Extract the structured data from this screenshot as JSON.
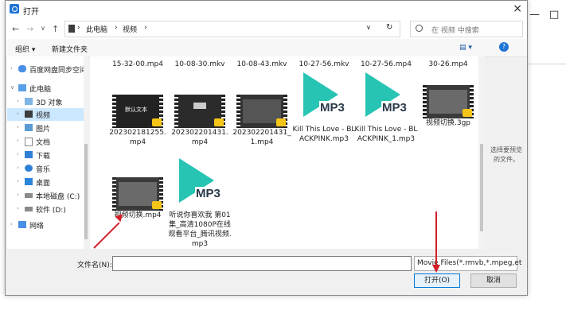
{
  "window": {
    "title": "打开",
    "close": "×"
  },
  "background_window": {
    "minimize": "—",
    "maximize": "□"
  },
  "nav_buttons": {
    "back": "←",
    "forward": "→",
    "dropdown": "∨",
    "up": "↑"
  },
  "address": {
    "segments": [
      "此电脑",
      "视频"
    ],
    "separator": "›",
    "expand": "∨",
    "refresh": "↻"
  },
  "search": {
    "placeholder": "在 视频 中搜索"
  },
  "commands": {
    "organize": "组织 ▾",
    "new_folder": "新建文件夹",
    "view": "▤ ▾",
    "help": "?"
  },
  "sidebar": {
    "items": [
      {
        "label": "百度网盘同步空间",
        "expand": "›",
        "icon": "cloud"
      },
      {
        "label": "此电脑",
        "expand": "∨",
        "icon": "pc"
      },
      {
        "label": "3D 对象",
        "expand": "›",
        "icon": "cube"
      },
      {
        "label": "视频",
        "expand": "›",
        "icon": "video",
        "selected": true
      },
      {
        "label": "图片",
        "expand": "›",
        "icon": "picture"
      },
      {
        "label": "文档",
        "expand": "›",
        "icon": "doc"
      },
      {
        "label": "下载",
        "expand": "›",
        "icon": "download"
      },
      {
        "label": "音乐",
        "expand": "›",
        "icon": "music"
      },
      {
        "label": "桌面",
        "expand": "›",
        "icon": "desktop"
      },
      {
        "label": "本地磁盘 (C:)",
        "expand": "›",
        "icon": "drive"
      },
      {
        "label": "软件 (D:)",
        "expand": "›",
        "icon": "drive"
      },
      {
        "label": "网络",
        "expand": "›",
        "icon": "network"
      }
    ]
  },
  "top_row": [
    "15-32-00.mp4",
    "10-08-30.mkv",
    "10-08-43.mkv",
    "10-27-56.mkv",
    "10-27-56.mp4",
    "30-26.mp4"
  ],
  "files_row1": [
    {
      "name": "202302181255.mp4",
      "kind": "video",
      "thumb_text": "默认文本"
    },
    {
      "name": "202302201431.mp4",
      "kind": "video",
      "thumb_text": ""
    },
    {
      "name": "202302201431_1.mp4",
      "kind": "video",
      "thumb_text": ""
    },
    {
      "name": "Kill This Love - BLACKPINK.mp3",
      "kind": "mp3",
      "badge": "MP3"
    },
    {
      "name": "Kill This Love - BLACKPINK_1.mp3",
      "kind": "mp3",
      "badge": "MP3"
    },
    {
      "name": "视频切换.3gp",
      "kind": "video",
      "thumb_text": ""
    }
  ],
  "files_row2": [
    {
      "name": "视频切换.mp4",
      "kind": "video",
      "thumb_text": ""
    },
    {
      "name": "听说你喜欢我 第01集_高清1080P在线观看平台_腾讯视频.mp3",
      "kind": "mp3",
      "badge": "MP3"
    }
  ],
  "preview_text": "选择要预览的文件。",
  "footer": {
    "filename_label": "文件名(N):",
    "filename_value": "",
    "filter_value": "Movie Files(*.rmvb,*.mpeg,et",
    "open": "打开(O)",
    "cancel": "取消"
  },
  "colors": {
    "accent": "#0078d7",
    "selected": "#cce8ff",
    "mp3_play": "#27c4b4",
    "annotation": "#d21f2a"
  }
}
